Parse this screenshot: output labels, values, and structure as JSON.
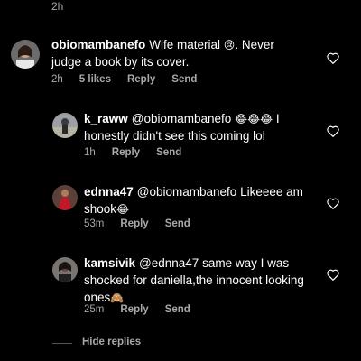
{
  "top_timestamp": "2h",
  "comments": [
    {
      "username": "obiomambanefo",
      "text_line1": "Wife material",
      "emoji_line1": "😢",
      "text_line1_after": ". Never",
      "text_line2": "judge a book by its cover.",
      "time": "2h",
      "likes": "5 likes",
      "reply_label": "Reply",
      "send_label": "Send"
    },
    {
      "username": "k_raww",
      "mention": "@obiomambanefo",
      "emojis": "😂😂😂",
      "text_line1_after": "I",
      "text_line2": "honestly didn't see this coming lol",
      "time": "1h",
      "reply_label": "Reply",
      "send_label": "Send"
    },
    {
      "username": "ednna47",
      "mention": "@obiomambanefo",
      "text_line1_after": "Likeeee am",
      "text_line2": "shook",
      "emoji_line2": "😂",
      "time": "53m",
      "reply_label": "Reply",
      "send_label": "Send"
    },
    {
      "username": "kamsivik",
      "mention": "@ednna47",
      "text_line1_after": "same way I was",
      "text_line2": "shocked for daniella,the innocent looking",
      "text_line3": "ones",
      "emoji_line3": "🙈",
      "time": "25m",
      "reply_label": "Reply",
      "send_label": "Send"
    }
  ],
  "hide_replies_label": "Hide replies",
  "icons": {
    "like": "heart-outline-icon"
  },
  "colors": {
    "background": "#000000",
    "primary_text": "#ffffff",
    "secondary_text": "#a8a8a8"
  }
}
